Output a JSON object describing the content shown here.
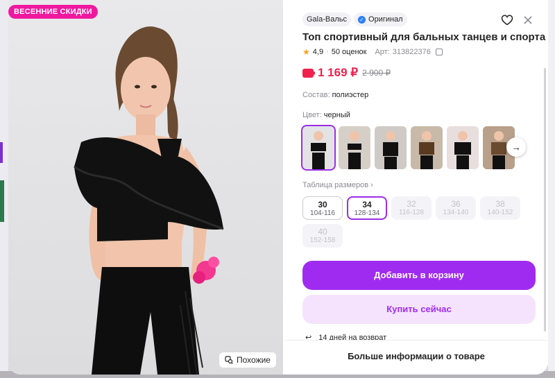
{
  "photo": {
    "badge": "ВЕСЕННИЕ СКИДКИ",
    "similar_label": "Похожие",
    "colors": {
      "badge": "#f0189f"
    }
  },
  "product": {
    "brand": "Gala-Вальс",
    "original_label": "Оригинал",
    "title": "Топ спортивный для бальных танцев и спорта",
    "rating": "4,9",
    "reviews": "50 оценок",
    "article_label": "Арт:",
    "article": "313822376",
    "price": "1 169 ₽",
    "old_price": "2 900 ₽",
    "composition_label": "Состав:",
    "composition_value": "полиэстер",
    "color_label": "Цвет:",
    "color_value": "черный",
    "size_table_label": "Таблица размеров",
    "sizes": [
      {
        "num": "30",
        "range": "104-116",
        "state": "available"
      },
      {
        "num": "34",
        "range": "128-134",
        "state": "selected"
      },
      {
        "num": "32",
        "range": "116-128",
        "state": "unavailable"
      },
      {
        "num": "36",
        "range": "134-140",
        "state": "unavailable"
      },
      {
        "num": "38",
        "range": "140-152",
        "state": "unavailable"
      },
      {
        "num": "40",
        "range": "152-158",
        "state": "unavailable"
      }
    ],
    "thumbnails": [
      "thumb-1",
      "thumb-2",
      "thumb-3",
      "thumb-4",
      "thumb-5",
      "thumb-6"
    ],
    "add_to_cart": "Добавить в корзину",
    "buy_now": "Купить сейчас",
    "return_text": "14 дней на возврат",
    "more_info": "Больше информации о товаре",
    "colors": {
      "accent": "#a02bf0",
      "price": "#f0214f"
    }
  },
  "icons": {
    "heart": "heart-icon",
    "close": "close-icon",
    "verified": "verified-icon",
    "star": "star-icon",
    "copy": "copy-icon",
    "wallet": "wallet-icon",
    "next": "arrow-right-icon",
    "return": "return-icon",
    "similar": "search-similar-icon"
  }
}
